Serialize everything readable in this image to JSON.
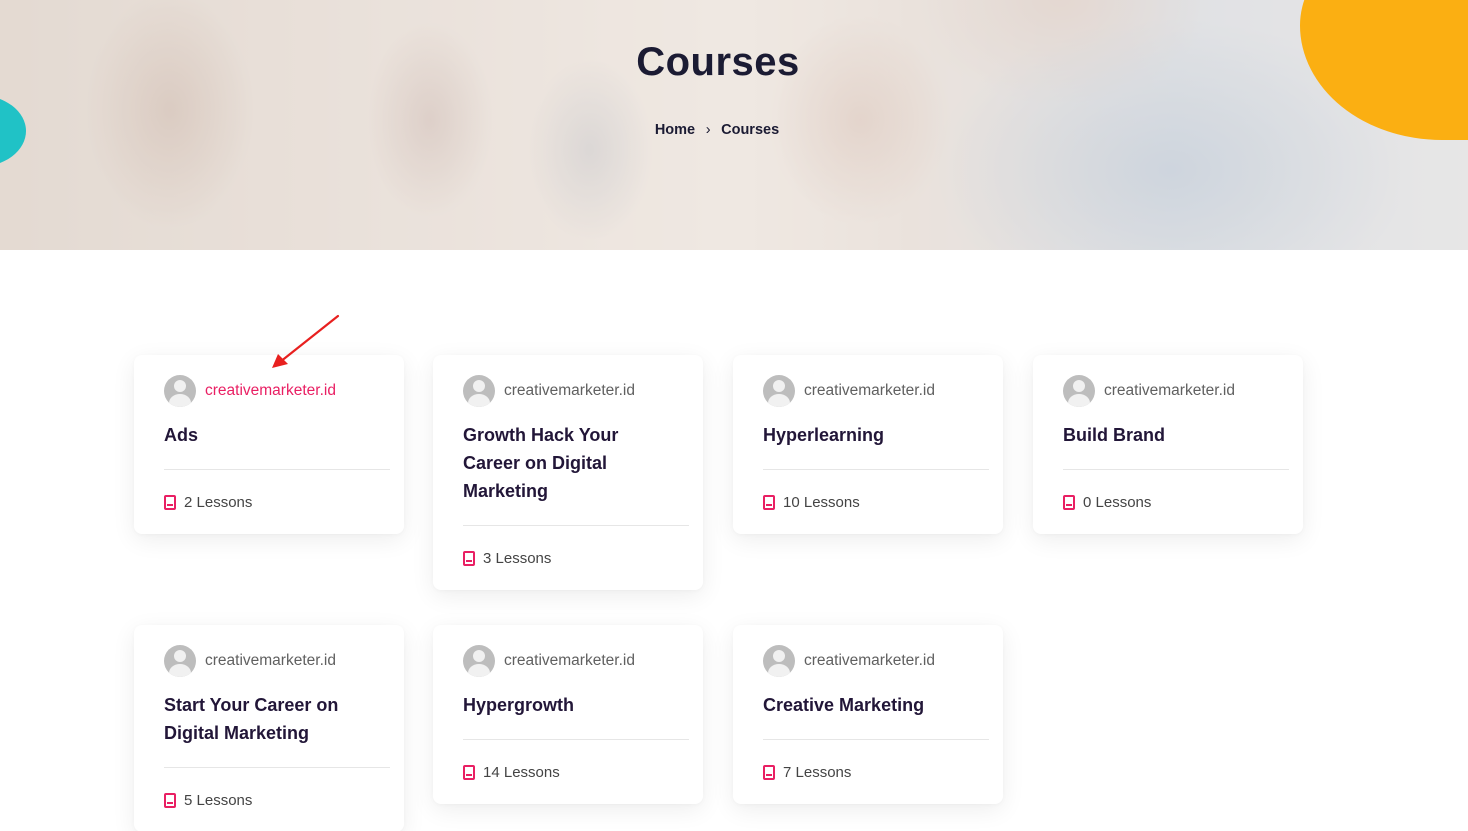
{
  "hero": {
    "title": "Courses",
    "breadcrumb": {
      "home": "Home",
      "separator": "›",
      "current": "Courses"
    }
  },
  "colors": {
    "accent": "#e91f63",
    "title": "#221638",
    "teal_blob": "#20c2c6",
    "yellow_blob": "#fbaf12"
  },
  "courses": [
    {
      "author": "creativemarketer.id",
      "title": "Ads",
      "lessons": "2 Lessons",
      "author_hover": true
    },
    {
      "author": "creativemarketer.id",
      "title": "Growth Hack Your Career on Digital Marketing",
      "lessons": "3 Lessons"
    },
    {
      "author": "creativemarketer.id",
      "title": "Hyperlearning",
      "lessons": "10 Lessons"
    },
    {
      "author": "creativemarketer.id",
      "title": "Build Brand",
      "lessons": "0 Lessons"
    },
    {
      "author": "creativemarketer.id",
      "title": "Start Your Career on Digital Marketing",
      "lessons": "5 Lessons"
    },
    {
      "author": "creativemarketer.id",
      "title": "Hypergrowth",
      "lessons": "14 Lessons"
    },
    {
      "author": "creativemarketer.id",
      "title": "Creative Marketing",
      "lessons": "7 Lessons"
    }
  ]
}
